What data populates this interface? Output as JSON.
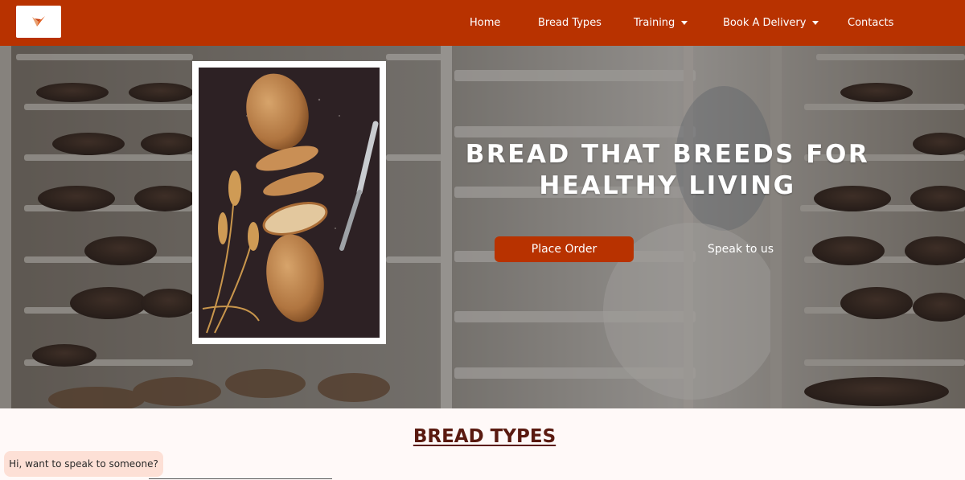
{
  "nav": {
    "logo_icon": "bird-logo-icon",
    "items": [
      {
        "label": "Home",
        "dropdown": false
      },
      {
        "label": "Bread Types",
        "dropdown": false
      },
      {
        "label": "Training",
        "dropdown": true
      },
      {
        "label": "Book A Delivery",
        "dropdown": true
      },
      {
        "label": "Contacts",
        "dropdown": false
      }
    ]
  },
  "hero": {
    "title_line1": "BREAD THAT BREEDS FOR",
    "title_line2": "HEALTHY LIVING",
    "primary_button": "Place Order",
    "secondary_button": "Speak to us",
    "image_icon": "bread-loaf-photo"
  },
  "section": {
    "title": "BREAD TYPES"
  },
  "chat": {
    "prompt": "Hi, want to speak to someone?"
  },
  "colors": {
    "brand": "#b83200",
    "page_bg": "#fff9f8",
    "section_title": "#5a1a10",
    "chat_bg": "#fde0d6"
  }
}
